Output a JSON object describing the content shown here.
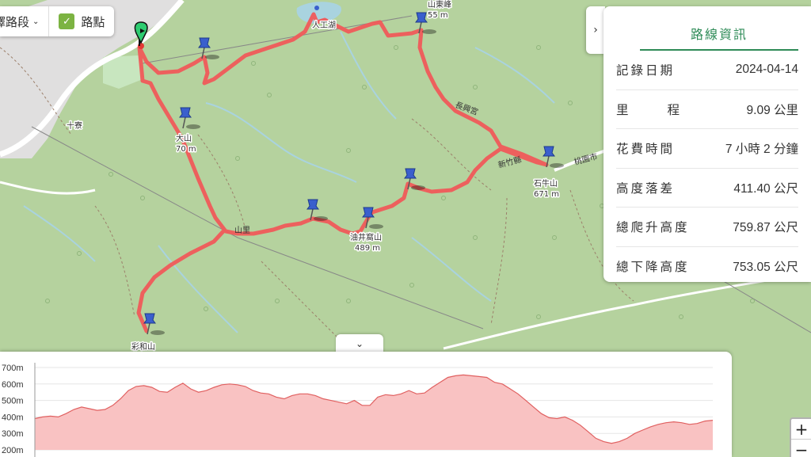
{
  "controls": {
    "route_select_label": "擇路段",
    "waypoint_toggle_label": "路點"
  },
  "info_panel": {
    "title": "路線資訊",
    "rows": [
      {
        "label": "記錄日期",
        "value": "2024-04-14"
      },
      {
        "label": "里程",
        "value": "9.09 公里"
      },
      {
        "label": "花費時間",
        "value": "7 小時 2 分鐘"
      },
      {
        "label": "高度落差",
        "value": "411.40 公尺"
      },
      {
        "label": "總爬升高度",
        "value": "759.87 公尺"
      },
      {
        "label": "總下降高度",
        "value": "753.05 公尺"
      }
    ]
  },
  "map": {
    "labels": {
      "peak_top": "山東峰",
      "peak_top_elev": "55 m",
      "reservoir": "人工湖",
      "village": "十寮",
      "peak_left": "大山",
      "peak_left_elev": "70 m",
      "peak_right": "石牛山",
      "peak_right_elev": "671 m",
      "peak_mid": "油井窩山",
      "peak_mid_elev": "489 m",
      "peak_bottom": "彩和山",
      "road_right": "新竹縣",
      "road_right2": "桃園市",
      "trail_mid": "山里",
      "trail_top_right": "長興宮"
    },
    "colors": {
      "track": "#f05a5a",
      "land": "#b5d29e",
      "water": "#a9d3df",
      "road": "#ffffff"
    }
  },
  "elevation": {
    "y_ticks": [
      "700m",
      "600m",
      "500m",
      "400m",
      "300m",
      "200m"
    ],
    "fill_color": "#f9c2c2",
    "line_color": "#e06060"
  },
  "chart_data": {
    "type": "area",
    "title": "",
    "xlabel": "",
    "ylabel": "",
    "ylim": [
      200,
      700
    ],
    "series": [
      {
        "values": [
          390,
          400,
          405,
          400,
          420,
          445,
          460,
          450,
          440,
          445,
          470,
          510,
          560,
          585,
          590,
          580,
          555,
          550,
          580,
          605,
          570,
          550,
          560,
          580,
          595,
          600,
          595,
          585,
          560,
          545,
          540,
          520,
          510,
          530,
          540,
          540,
          530,
          510,
          500,
          490,
          480,
          500,
          470,
          470,
          520,
          535,
          530,
          540,
          560,
          540,
          545,
          580,
          610,
          640,
          650,
          655,
          650,
          645,
          640,
          610,
          600,
          570,
          540,
          500,
          460,
          420,
          395,
          390,
          400,
          380,
          350,
          310,
          270,
          250,
          240,
          250,
          270,
          300,
          320,
          340,
          355,
          365,
          370,
          365,
          355,
          360,
          375,
          380
        ]
      }
    ]
  }
}
